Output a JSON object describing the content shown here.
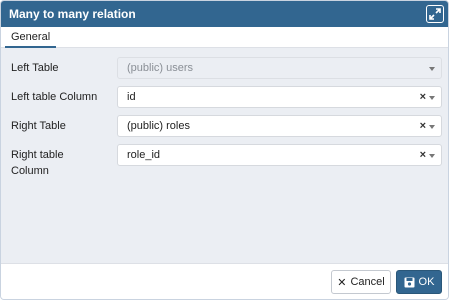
{
  "dialog": {
    "title": "Many to many relation",
    "expand_icon": "expand-icon"
  },
  "tabs": [
    {
      "label": "General",
      "active": true
    }
  ],
  "form": {
    "left_table": {
      "label": "Left Table",
      "value": "(public) users",
      "disabled": true
    },
    "left_column": {
      "label": "Left table Column",
      "value": "id",
      "clear": "×"
    },
    "right_table": {
      "label": "Right Table",
      "value": "(public) roles",
      "clear": "×"
    },
    "right_column": {
      "label_line1": "Right table",
      "label_line2": "Column",
      "value": "role_id",
      "clear": "×"
    }
  },
  "footer": {
    "cancel_label": "Cancel",
    "cancel_icon": "✕",
    "ok_label": "OK",
    "ok_icon": "save-icon"
  },
  "colors": {
    "header": "#326690",
    "body_bg": "#ebeef3"
  }
}
